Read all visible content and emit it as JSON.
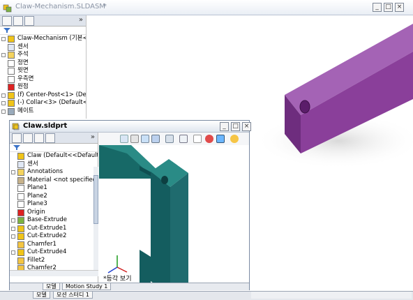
{
  "assembly_window": {
    "title": "Claw-Mechanism.SLDASM",
    "title_suffix": "*",
    "window_buttons": [
      "_",
      "□",
      "×"
    ],
    "tree": [
      {
        "label": "Claw-Mechanism  (기본<",
        "icon": "assembly-icon",
        "expander": "-"
      },
      {
        "label": "센서",
        "icon": "sensor-icon",
        "expander": ""
      },
      {
        "label": "주석",
        "icon": "annotations-icon",
        "expander": "+"
      },
      {
        "label": "정면",
        "icon": "plane-icon",
        "expander": ""
      },
      {
        "label": "윗면",
        "icon": "plane-icon",
        "expander": ""
      },
      {
        "label": "우측면",
        "icon": "plane-icon",
        "expander": ""
      },
      {
        "label": "원점",
        "icon": "origin-icon",
        "expander": ""
      },
      {
        "label": "(f) Center-Post<1> (De",
        "icon": "part-icon",
        "expander": "+"
      },
      {
        "label": "(-) Collar<3> (Default<",
        "icon": "part-icon",
        "expander": "+"
      },
      {
        "label": "메이트",
        "icon": "mates-icon",
        "expander": "+"
      }
    ],
    "bottom_tabs": [
      "모델",
      "모션 스터디 1"
    ]
  },
  "part_window": {
    "title": "Claw.sldprt",
    "window_buttons": [
      "_",
      "□",
      "×"
    ],
    "tree": [
      {
        "label": "Claw  (Default<<Default>_",
        "icon": "part-icon",
        "expander": ""
      },
      {
        "label": "센서",
        "icon": "sensor-icon",
        "expander": ""
      },
      {
        "label": "Annotations",
        "icon": "annotations-icon",
        "expander": "+"
      },
      {
        "label": "Material <not specified>",
        "icon": "material-icon",
        "expander": ""
      },
      {
        "label": "Plane1",
        "icon": "plane-icon",
        "expander": ""
      },
      {
        "label": "Plane2",
        "icon": "plane-icon",
        "expander": ""
      },
      {
        "label": "Plane3",
        "icon": "plane-icon",
        "expander": ""
      },
      {
        "label": "Origin",
        "icon": "origin-icon",
        "expander": ""
      },
      {
        "label": "Base-Extrude",
        "icon": "extrude-icon",
        "expander": "+"
      },
      {
        "label": "Cut-Extrude1",
        "icon": "cut-icon",
        "expander": "+"
      },
      {
        "label": "Cut-Extrude2",
        "icon": "cut-icon",
        "expander": "+"
      },
      {
        "label": "Chamfer1",
        "icon": "chamfer-icon",
        "expander": ""
      },
      {
        "label": "Cut-Extrude4",
        "icon": "cut-icon",
        "expander": "+"
      },
      {
        "label": "Fillet2",
        "icon": "fillet-icon",
        "expander": ""
      },
      {
        "label": "Chamfer2",
        "icon": "chamfer-icon",
        "expander": ""
      }
    ],
    "view_label": "*등각 보기",
    "bottom_tabs": [
      "모델",
      "Motion Study 1"
    ]
  },
  "colors": {
    "assembly_part": "#8a3f9a",
    "part_model": "#1f6b6e"
  }
}
